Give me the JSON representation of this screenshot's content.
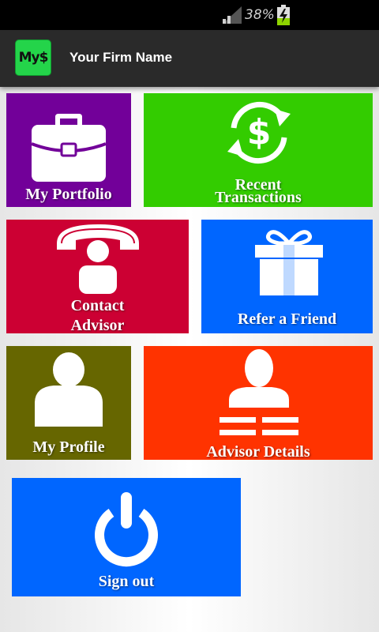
{
  "status_bar": {
    "battery_percent": "38%"
  },
  "app_bar": {
    "logo_text": "My$",
    "title": "Your Firm Name"
  },
  "colors": {
    "portfolio": "#720099",
    "transactions": "#33cc00",
    "contact": "#cc0033",
    "refer": "#0066ff",
    "profile": "#666600",
    "advisor_details": "#ff3300",
    "signout": "#0066ff"
  },
  "tiles": {
    "portfolio": {
      "label": "My Portfolio",
      "icon": "briefcase-icon"
    },
    "transactions": {
      "label_line1": "Recent",
      "label_line2": "Transactions",
      "icon": "dollar-refresh-icon"
    },
    "contact": {
      "label_line1": "Contact",
      "label_line2": "Advisor",
      "icon": "phone-person-icon"
    },
    "refer": {
      "label": "Refer a Friend",
      "icon": "gift-icon"
    },
    "profile": {
      "label": "My Profile",
      "icon": "user-icon"
    },
    "advisor_details": {
      "label": "Advisor Details",
      "icon": "user-card-icon"
    },
    "signout": {
      "label": "Sign out",
      "icon": "power-icon"
    }
  }
}
